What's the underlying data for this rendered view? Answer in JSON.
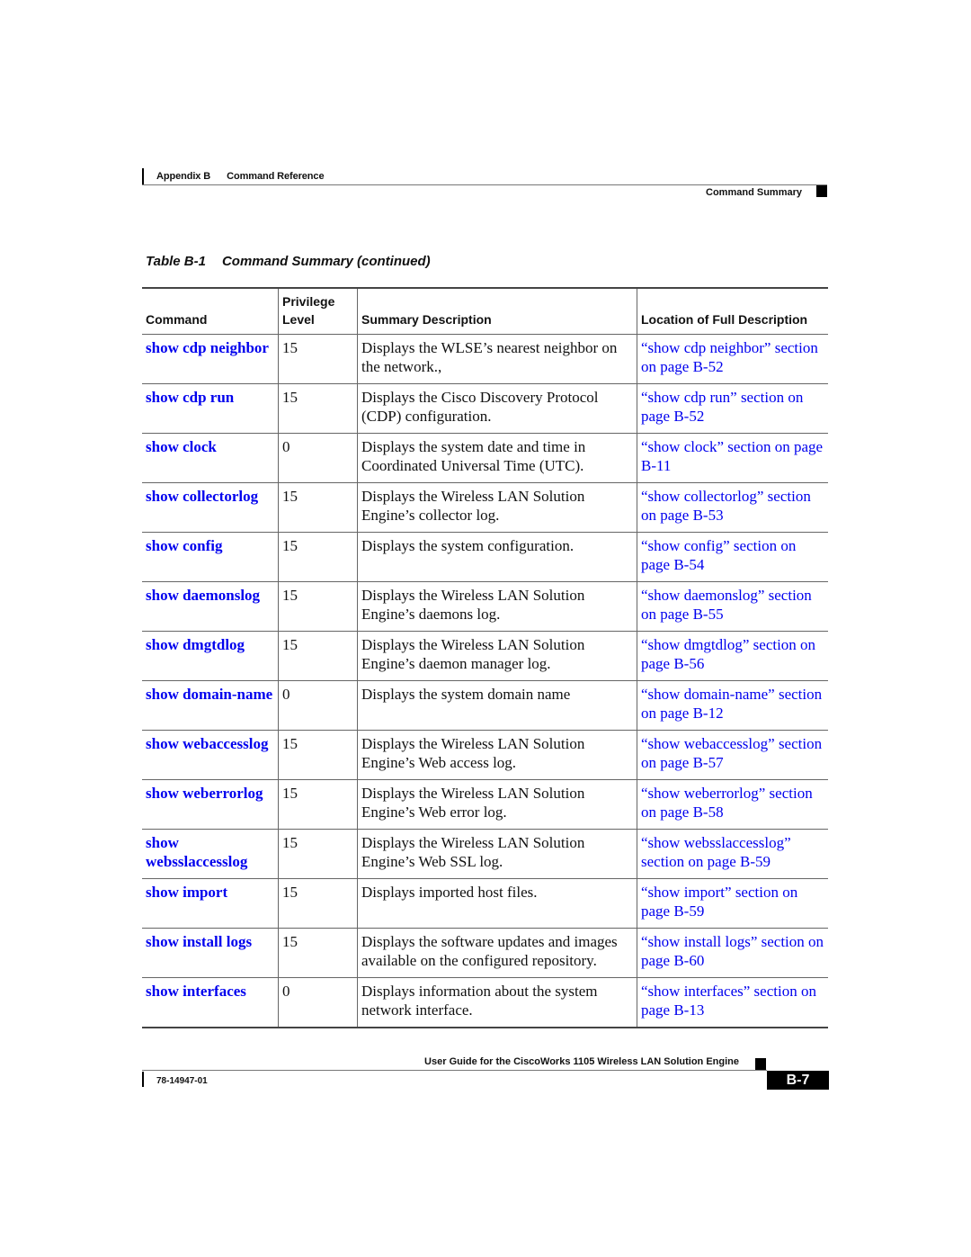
{
  "header": {
    "appendix": "Appendix B",
    "chapter": "Command Reference",
    "section": "Command Summary"
  },
  "caption": {
    "label": "Table B-1",
    "title": "Command Summary (continued)"
  },
  "table": {
    "columns": {
      "command": "Command",
      "privilege_line1": "Privilege",
      "privilege_line2": "Level",
      "summary": "Summary Description",
      "location": "Location of Full Description"
    },
    "rows": [
      {
        "command": "show cdp neighbor",
        "level": "15",
        "summary": "Displays the WLSE’s nearest neighbor on the network.,",
        "location": "“show cdp neighbor” section on page B-52"
      },
      {
        "command": "show cdp run",
        "level": "15",
        "summary": "Displays the Cisco Discovery Protocol (CDP) configuration.",
        "location": "“show cdp run” section on page B-52"
      },
      {
        "command": "show clock",
        "level": "0",
        "summary": "Displays the system date and time in Coordinated Universal Time (UTC).",
        "location": "“show clock” section on page B-11"
      },
      {
        "command": "show collectorlog",
        "level": "15",
        "summary": "Displays the Wireless LAN Solution Engine’s collector log.",
        "location": "“show collectorlog” section on page B-53"
      },
      {
        "command": "show config",
        "level": "15",
        "summary": "Displays the system configuration.",
        "location": "“show config” section on page B-54"
      },
      {
        "command": "show daemonslog",
        "level": "15",
        "summary": "Displays the Wireless LAN Solution Engine’s daemons log.",
        "location": "“show daemonslog” section on page B-55"
      },
      {
        "command": "show dmgtdlog",
        "level": "15",
        "summary": "Displays the Wireless LAN Solution Engine’s daemon manager log.",
        "location": "“show dmgtdlog” section on page B-56"
      },
      {
        "command": "show domain-name",
        "level": "0",
        "summary": "Displays the system domain name",
        "location": "“show domain-name” section on page B-12"
      },
      {
        "command": "show webaccesslog",
        "level": "15",
        "summary": "Displays the Wireless LAN Solution Engine’s Web access log.",
        "location": "“show webaccesslog” section on page B-57"
      },
      {
        "command": "show weberrorlog",
        "level": "15",
        "summary": "Displays the Wireless LAN Solution Engine’s Web error log.",
        "location": "“show weberrorlog” section on page B-58"
      },
      {
        "command": "show websslaccesslog",
        "level": "15",
        "summary": "Displays the Wireless LAN Solution Engine’s Web SSL log.",
        "location": "“show websslaccesslog” section on page B-59"
      },
      {
        "command": "show import",
        "level": "15",
        "summary": "Displays imported host files.",
        "location": "“show import” section on page B-59"
      },
      {
        "command": "show install logs",
        "level": "15",
        "summary": "Displays the software updates and images available on the configured repository.",
        "location": "“show install logs” section on page B-60"
      },
      {
        "command": "show interfaces",
        "level": "0",
        "summary": "Displays information about the system network interface.",
        "location": "“show interfaces” section on page B-13"
      }
    ]
  },
  "footer": {
    "title": "User Guide for the CiscoWorks 1105 Wireless LAN Solution Engine",
    "doc_number": "78-14947-01",
    "page": "B-7"
  },
  "colors": {
    "link": "#0000ee",
    "text": "#111111",
    "rule": "#666666"
  }
}
